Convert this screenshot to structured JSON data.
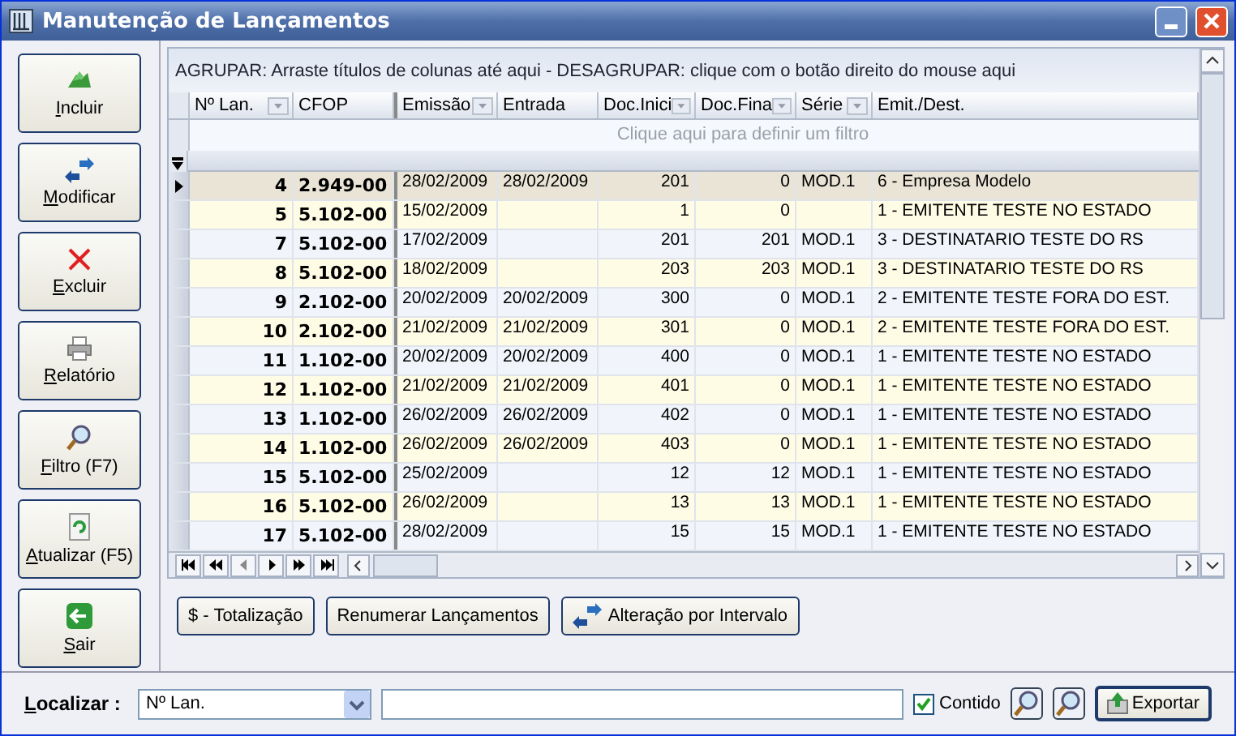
{
  "window": {
    "title": "Manutenção de Lançamentos"
  },
  "side_buttons": [
    "Incluir",
    "Modificar",
    "Excluir",
    "Relatório",
    "Filtro (F7)",
    "Atualizar (F5)",
    "Sair"
  ],
  "group_panel": "AGRUPAR: Arraste títulos de colunas até aqui - DESAGRUPAR: clique com o botão direito do mouse aqui",
  "table": {
    "columns": [
      "Nº Lan.",
      "CFOP",
      "Emissão",
      "Entrada",
      "Doc.Inici",
      "Doc.Fina",
      "Série",
      "Emit./Dest."
    ],
    "filter_placeholder": "Clique aqui para definir um filtro",
    "rows": [
      {
        "selected": true,
        "cells": [
          "4",
          "2.949-00",
          "28/02/2009",
          "28/02/2009",
          "201",
          "0",
          "MOD.1",
          "6 - Empresa Modelo"
        ]
      },
      {
        "selected": false,
        "cells": [
          "5",
          "5.102-00",
          "15/02/2009",
          "",
          "1",
          "0",
          "",
          "1 - EMITENTE TESTE NO ESTADO"
        ]
      },
      {
        "selected": false,
        "cells": [
          "7",
          "5.102-00",
          "17/02/2009",
          "",
          "201",
          "201",
          "MOD.1",
          "3 - DESTINATARIO TESTE DO RS"
        ]
      },
      {
        "selected": false,
        "cells": [
          "8",
          "5.102-00",
          "18/02/2009",
          "",
          "203",
          "203",
          "MOD.1",
          "3 - DESTINATARIO TESTE DO RS"
        ]
      },
      {
        "selected": false,
        "cells": [
          "9",
          "2.102-00",
          "20/02/2009",
          "20/02/2009",
          "300",
          "0",
          "MOD.1",
          "2 - EMITENTE TESTE FORA DO EST."
        ]
      },
      {
        "selected": false,
        "cells": [
          "10",
          "2.102-00",
          "21/02/2009",
          "21/02/2009",
          "301",
          "0",
          "MOD.1",
          "2 - EMITENTE TESTE FORA DO EST."
        ]
      },
      {
        "selected": false,
        "cells": [
          "11",
          "1.102-00",
          "20/02/2009",
          "20/02/2009",
          "400",
          "0",
          "MOD.1",
          "1 - EMITENTE TESTE NO ESTADO"
        ]
      },
      {
        "selected": false,
        "cells": [
          "12",
          "1.102-00",
          "21/02/2009",
          "21/02/2009",
          "401",
          "0",
          "MOD.1",
          "1 - EMITENTE TESTE NO ESTADO"
        ]
      },
      {
        "selected": false,
        "cells": [
          "13",
          "1.102-00",
          "26/02/2009",
          "26/02/2009",
          "402",
          "0",
          "MOD.1",
          "1 - EMITENTE TESTE NO ESTADO"
        ]
      },
      {
        "selected": false,
        "cells": [
          "14",
          "1.102-00",
          "26/02/2009",
          "26/02/2009",
          "403",
          "0",
          "MOD.1",
          "1 - EMITENTE TESTE NO ESTADO"
        ]
      },
      {
        "selected": false,
        "cells": [
          "15",
          "5.102-00",
          "25/02/2009",
          "",
          "12",
          "12",
          "MOD.1",
          "1 - EMITENTE TESTE NO ESTADO"
        ]
      },
      {
        "selected": false,
        "cells": [
          "16",
          "5.102-00",
          "26/02/2009",
          "",
          "13",
          "13",
          "MOD.1",
          "1 - EMITENTE TESTE NO ESTADO"
        ]
      },
      {
        "selected": false,
        "cells": [
          "17",
          "5.102-00",
          "28/02/2009",
          "",
          "15",
          "15",
          "MOD.1",
          "1 - EMITENTE TESTE NO ESTADO"
        ]
      }
    ]
  },
  "action_buttons": [
    "$ - Totalização",
    "Renumerar Lançamentos",
    "Alteração por Intervalo"
  ],
  "search_bar": {
    "label": "Localizar :",
    "field": "Nº Lan.",
    "contido": {
      "label": "Contido",
      "checked": true
    },
    "export_label": "Exportar"
  }
}
